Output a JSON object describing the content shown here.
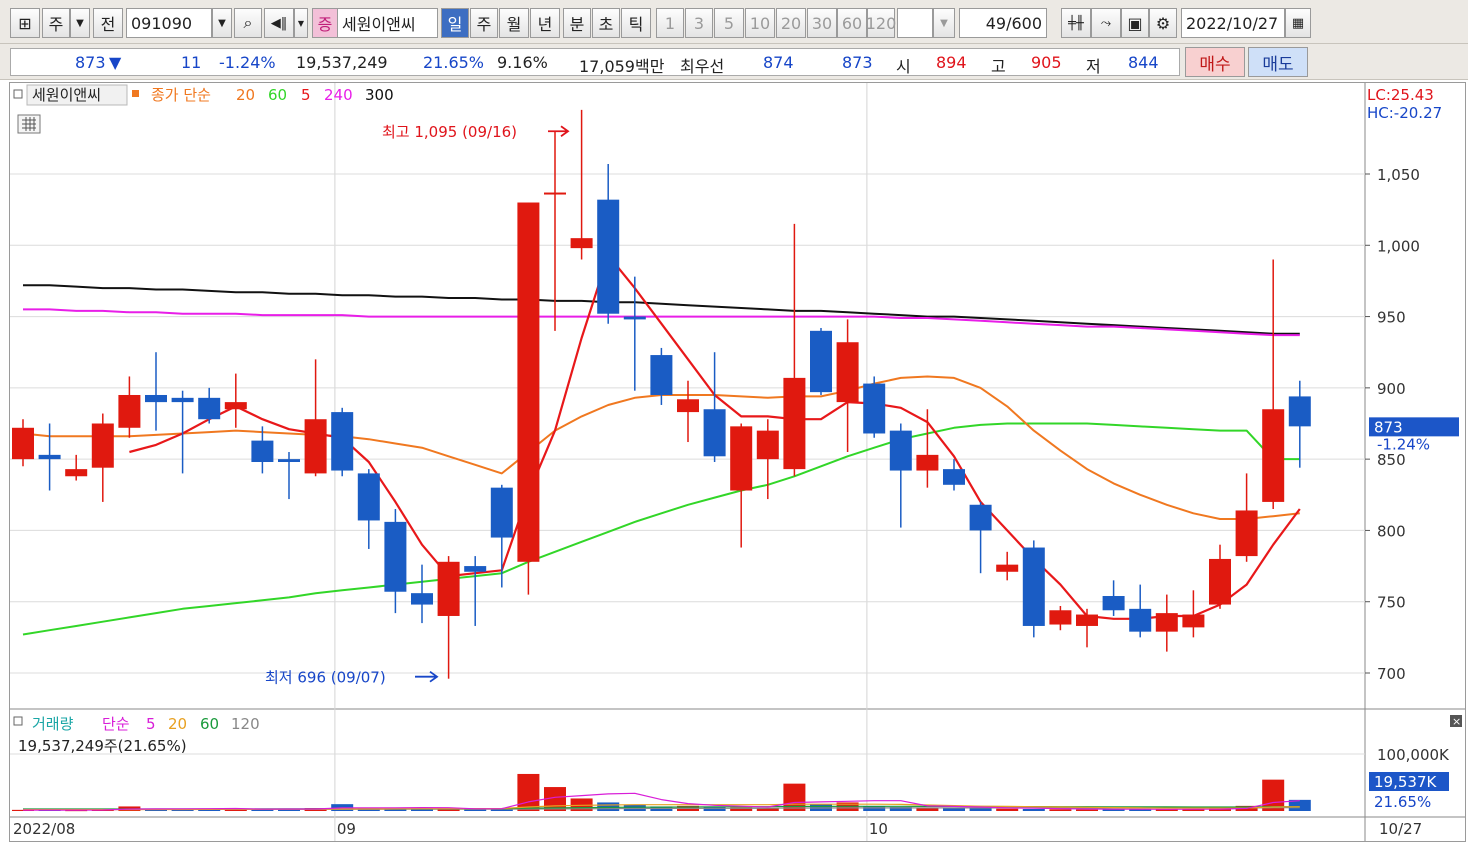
{
  "toolbar": {
    "mode_btn": "주",
    "prev_btn": "전",
    "stock_code": "091090",
    "stock_badge": "증",
    "stock_name": "세원이앤씨",
    "periods": [
      "일",
      "주",
      "월",
      "년",
      "분",
      "초",
      "틱"
    ],
    "active_period": "일",
    "intervals": [
      "1",
      "3",
      "5",
      "10",
      "20",
      "30",
      "60",
      "120"
    ],
    "count": "49",
    "count_max": "/600",
    "date": "2022/10/27"
  },
  "quote": {
    "price": "873",
    "change_arrow": "▼",
    "change": "11",
    "change_pct": "-1.24%",
    "volume": "19,537,249",
    "volume_ratio": "21.65%",
    "turnover": "9.16%",
    "amount": "17,059백만",
    "best_label": "최우선",
    "best_ask": "874",
    "best_bid": "873",
    "open_label": "시",
    "open": "894",
    "high_label": "고",
    "high": "905",
    "low_label": "저",
    "low": "844",
    "buy_label": "매수",
    "sell_label": "매도"
  },
  "colors": {
    "up": "#e0190f",
    "down": "#1a5cc4",
    "ma5": "#e8181a",
    "ma20": "#f07820",
    "ma60": "#32d628",
    "ma240": "#e81ee8",
    "ma300": "#111111"
  },
  "chart_data": [
    {
      "type": "candlestick",
      "title": "세원이앤씨",
      "legend": {
        "price_label": "종가 단순",
        "ma_labels": [
          "20",
          "60",
          "5",
          "240",
          "300"
        ],
        "ma_colors": [
          "#f07820",
          "#32d628",
          "#e8181a",
          "#e81ee8",
          "#111111"
        ]
      },
      "lc_label": "LC:25.43",
      "hc_label": "HC:-20.27",
      "current_price_label": "873",
      "current_change_label": "-1.24%",
      "high_annotation": "최고 1,095 (09/16)",
      "low_annotation": "최저 696 (09/07)",
      "y_ticks": [
        700,
        750,
        800,
        850,
        900,
        950,
        1000,
        1050
      ],
      "y_tick_labels": [
        "700",
        "750",
        "800",
        "850",
        "900",
        "950",
        "1,000",
        "1,050"
      ],
      "ylim": [
        660,
        1110
      ],
      "x_labels": [
        {
          "idx": 0,
          "label": "2022/08"
        },
        {
          "idx": 12,
          "label": "09"
        },
        {
          "idx": 32,
          "label": "10"
        },
        {
          "idx": 48,
          "label": "10/27"
        }
      ],
      "candles": [
        {
          "o": 850,
          "h": 878,
          "l": 845,
          "c": 872
        },
        {
          "o": 853,
          "h": 875,
          "l": 828,
          "c": 850
        },
        {
          "o": 838,
          "h": 853,
          "l": 835,
          "c": 843
        },
        {
          "o": 844,
          "h": 882,
          "l": 820,
          "c": 875
        },
        {
          "o": 872,
          "h": 908,
          "l": 865,
          "c": 895
        },
        {
          "o": 895,
          "h": 925,
          "l": 870,
          "c": 890
        },
        {
          "o": 893,
          "h": 898,
          "l": 840,
          "c": 890
        },
        {
          "o": 893,
          "h": 900,
          "l": 875,
          "c": 878
        },
        {
          "o": 885,
          "h": 910,
          "l": 872,
          "c": 890
        },
        {
          "o": 863,
          "h": 873,
          "l": 840,
          "c": 848
        },
        {
          "o": 850,
          "h": 855,
          "l": 822,
          "c": 848
        },
        {
          "o": 840,
          "h": 920,
          "l": 838,
          "c": 878
        },
        {
          "o": 883,
          "h": 886,
          "l": 838,
          "c": 842
        },
        {
          "o": 840,
          "h": 843,
          "l": 787,
          "c": 807
        },
        {
          "o": 806,
          "h": 815,
          "l": 742,
          "c": 757
        },
        {
          "o": 756,
          "h": 776,
          "l": 735,
          "c": 748
        },
        {
          "o": 740,
          "h": 782,
          "l": 696,
          "c": 778
        },
        {
          "o": 775,
          "h": 782,
          "l": 733,
          "c": 771
        },
        {
          "o": 830,
          "h": 832,
          "l": 760,
          "c": 795
        },
        {
          "o": 778,
          "h": 1030,
          "l": 755,
          "c": 1030
        },
        {
          "o": 1037,
          "h": 1080,
          "l": 940,
          "c": 1037
        },
        {
          "o": 998,
          "h": 1095,
          "l": 990,
          "c": 1005
        },
        {
          "o": 1032,
          "h": 1057,
          "l": 945,
          "c": 952
        },
        {
          "o": 950,
          "h": 978,
          "l": 898,
          "c": 948
        },
        {
          "o": 923,
          "h": 928,
          "l": 888,
          "c": 895
        },
        {
          "o": 883,
          "h": 905,
          "l": 862,
          "c": 892
        },
        {
          "o": 885,
          "h": 925,
          "l": 848,
          "c": 852
        },
        {
          "o": 828,
          "h": 875,
          "l": 788,
          "c": 873
        },
        {
          "o": 850,
          "h": 878,
          "l": 822,
          "c": 870
        },
        {
          "o": 843,
          "h": 1015,
          "l": 838,
          "c": 907
        },
        {
          "o": 940,
          "h": 942,
          "l": 895,
          "c": 897
        },
        {
          "o": 890,
          "h": 948,
          "l": 855,
          "c": 932
        },
        {
          "o": 903,
          "h": 908,
          "l": 865,
          "c": 868
        },
        {
          "o": 870,
          "h": 875,
          "l": 802,
          "c": 842
        },
        {
          "o": 842,
          "h": 885,
          "l": 830,
          "c": 853
        },
        {
          "o": 843,
          "h": 850,
          "l": 828,
          "c": 832
        },
        {
          "o": 818,
          "h": 820,
          "l": 770,
          "c": 800
        },
        {
          "o": 771,
          "h": 785,
          "l": 765,
          "c": 776
        },
        {
          "o": 788,
          "h": 793,
          "l": 725,
          "c": 733
        },
        {
          "o": 734,
          "h": 747,
          "l": 730,
          "c": 744
        },
        {
          "o": 733,
          "h": 745,
          "l": 718,
          "c": 741
        },
        {
          "o": 754,
          "h": 765,
          "l": 740,
          "c": 744
        },
        {
          "o": 745,
          "h": 762,
          "l": 725,
          "c": 729
        },
        {
          "o": 729,
          "h": 755,
          "l": 715,
          "c": 742
        },
        {
          "o": 732,
          "h": 758,
          "l": 725,
          "c": 741
        },
        {
          "o": 748,
          "h": 790,
          "l": 745,
          "c": 780
        },
        {
          "o": 782,
          "h": 840,
          "l": 778,
          "c": 814
        },
        {
          "o": 820,
          "h": 990,
          "l": 815,
          "c": 885
        },
        {
          "o": 894,
          "h": 905,
          "l": 844,
          "c": 873
        }
      ],
      "ma5": [
        null,
        null,
        null,
        null,
        855,
        860,
        868,
        878,
        887,
        878,
        871,
        868,
        865,
        848,
        820,
        790,
        768,
        770,
        772,
        826,
        870,
        935,
        993,
        970,
        945,
        920,
        895,
        880,
        880,
        878,
        878,
        890,
        889,
        886,
        876,
        852,
        820,
        800,
        780,
        762,
        740,
        738,
        738,
        740,
        740,
        748,
        762,
        790,
        815
      ],
      "ma20": [
        868,
        866,
        866,
        866,
        866,
        867,
        868,
        869,
        870,
        869,
        868,
        867,
        866,
        864,
        861,
        858,
        852,
        846,
        840,
        855,
        870,
        880,
        888,
        893,
        895,
        895,
        895,
        894,
        893,
        894,
        894,
        898,
        903,
        907,
        908,
        907,
        900,
        887,
        870,
        856,
        843,
        833,
        825,
        818,
        812,
        808,
        808,
        810,
        812
      ],
      "ma60": [
        727,
        730,
        733,
        736,
        739,
        742,
        745,
        747,
        749,
        751,
        753,
        756,
        758,
        760,
        762,
        764,
        766,
        768,
        770,
        778,
        785,
        792,
        799,
        806,
        812,
        818,
        823,
        828,
        832,
        838,
        845,
        852,
        858,
        864,
        868,
        872,
        874,
        875,
        875,
        875,
        875,
        874,
        873,
        872,
        871,
        870,
        870,
        850,
        850
      ],
      "ma240": [
        955,
        955,
        954,
        954,
        953,
        953,
        952,
        952,
        952,
        951,
        951,
        951,
        951,
        950,
        950,
        950,
        950,
        950,
        950,
        950,
        950,
        950,
        950,
        950,
        950,
        950,
        950,
        950,
        950,
        950,
        950,
        950,
        950,
        949,
        949,
        948,
        947,
        946,
        945,
        944,
        943,
        943,
        942,
        941,
        940,
        939,
        938,
        937,
        937
      ],
      "ma300": [
        972,
        972,
        971,
        970,
        970,
        969,
        969,
        968,
        967,
        967,
        966,
        966,
        965,
        965,
        964,
        964,
        963,
        963,
        962,
        962,
        961,
        961,
        960,
        960,
        959,
        958,
        957,
        956,
        955,
        954,
        954,
        953,
        952,
        951,
        950,
        950,
        949,
        948,
        947,
        946,
        945,
        944,
        943,
        942,
        941,
        940,
        939,
        938,
        938
      ]
    },
    {
      "type": "bar",
      "title": "거래량",
      "legend": {
        "price_label": "단순",
        "ma_labels": [
          "5",
          "20",
          "60",
          "120"
        ],
        "ma_colors": [
          "#d81ed8",
          "#e8a020",
          "#1a9a3c",
          "#888888"
        ]
      },
      "info": "19,537,249주(21.65%)",
      "y_tick_label": "100,000K",
      "current_volume_label": "19,537K",
      "current_ratio_label": "21.65%",
      "ylim": [
        0,
        120000
      ],
      "volume_k": [
        2000,
        2000,
        1500,
        3000,
        8000,
        4000,
        3000,
        2500,
        4000,
        3500,
        2500,
        5000,
        12000,
        5000,
        4000,
        3500,
        4500,
        2500,
        5000,
        65000,
        42000,
        22000,
        15000,
        11000,
        8000,
        9000,
        7000,
        6000,
        5000,
        48000,
        12000,
        15000,
        8000,
        7000,
        5000,
        5000,
        4500,
        4000,
        3500,
        3000,
        2500,
        3000,
        3500,
        3000,
        3500,
        4000,
        9000,
        55000,
        19537
      ],
      "ma5": [
        1500,
        1500,
        1500,
        1800,
        3300,
        3700,
        3900,
        4000,
        4300,
        3400,
        3500,
        3500,
        5500,
        5600,
        5700,
        6000,
        5800,
        3800,
        4000,
        16000,
        24000,
        27000,
        30000,
        31000,
        20000,
        13000,
        10000,
        8500,
        7000,
        15000,
        16000,
        17000,
        18000,
        18000,
        9000,
        8000,
        7000,
        5500,
        5000,
        4000,
        3500,
        3200,
        3100,
        3000,
        3100,
        3400,
        4600,
        15000,
        18000
      ],
      "ma20": [
        2500,
        2500,
        2500,
        2500,
        2500,
        2600,
        2700,
        2800,
        2900,
        3000,
        3100,
        3200,
        3500,
        3700,
        3900,
        4000,
        4100,
        4200,
        4300,
        7000,
        9000,
        10000,
        10500,
        11000,
        11000,
        11000,
        11000,
        11000,
        11000,
        12000,
        12000,
        12000,
        12000,
        11500,
        10500,
        9500,
        8500,
        8000,
        7500,
        7000,
        6500,
        6000,
        5500,
        5000,
        5000,
        5000,
        5200,
        7000,
        7500
      ],
      "ma60": [
        3500,
        3500,
        3500,
        3500,
        3500,
        3500,
        3500,
        3500,
        3500,
        3600,
        3600,
        3600,
        3700,
        3700,
        3800,
        3800,
        3900,
        3900,
        4000,
        5000,
        5500,
        6000,
        6300,
        6600,
        6900,
        7100,
        7300,
        7400,
        7500,
        8000,
        8100,
        8200,
        8200,
        8200,
        8100,
        8000,
        7900,
        7800,
        7700,
        7600,
        7500,
        7400,
        7300,
        7200,
        7100,
        7000,
        7000,
        7500,
        7600
      ],
      "ma120": [
        3000,
        3000,
        3000,
        3000,
        3000,
        3000,
        3000,
        3000,
        3000,
        3000,
        3000,
        3000,
        3000,
        3000,
        3100,
        3100,
        3100,
        3100,
        3100,
        3500,
        3700,
        3900,
        4100,
        4300,
        4500,
        4600,
        4700,
        4800,
        4900,
        5200,
        5300,
        5400,
        5500,
        5500,
        5500,
        5500,
        5500,
        5500,
        5500,
        5500,
        5500,
        5500,
        5500,
        5500,
        5500,
        5500,
        5500,
        5800,
        5900
      ]
    }
  ]
}
